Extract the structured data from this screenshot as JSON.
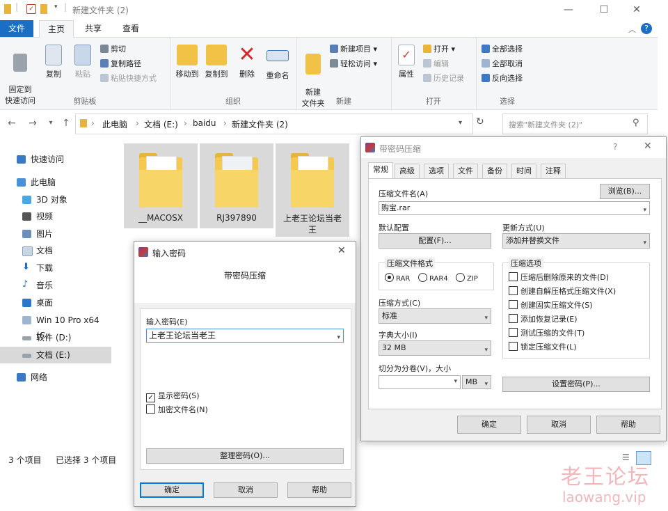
{
  "explorer": {
    "window_title": "新建文件夹 (2)",
    "ribbon_tabs": [
      "文件",
      "主页",
      "共享",
      "查看"
    ],
    "clipboard_group": {
      "label": "剪贴板",
      "pin": "固定到\n快速访问",
      "copy": "复制",
      "paste": "粘贴",
      "cut": "剪切",
      "copy_path": "复制路径",
      "paste_shortcut": "粘贴快捷方式"
    },
    "organize_group": {
      "label": "组织",
      "move_to": "移动到",
      "copy_to": "复制到",
      "delete": "删除",
      "rename": "重命名"
    },
    "new_group": {
      "label": "新建",
      "new_folder": "新建\n文件夹",
      "new_item": "新建项目 ▾",
      "easy_access": "轻松访问 ▾"
    },
    "open_group": {
      "label": "打开",
      "properties": "属性",
      "open": "打开 ▾",
      "edit": "编辑",
      "history": "历史记录"
    },
    "select_group": {
      "label": "选择",
      "select_all": "全部选择",
      "select_none": "全部取消",
      "invert": "反向选择"
    },
    "breadcrumb": [
      "此电脑",
      "文档 (E:)",
      "baidu",
      "新建文件夹 (2)"
    ],
    "search_placeholder": "搜索\"新建文件夹 (2)\"",
    "sidebar": [
      {
        "label": "快速访问"
      },
      {
        "label": "此电脑"
      },
      {
        "label": "3D 对象"
      },
      {
        "label": "视频"
      },
      {
        "label": "图片"
      },
      {
        "label": "文档"
      },
      {
        "label": "下载"
      },
      {
        "label": "音乐"
      },
      {
        "label": "桌面"
      },
      {
        "label": "Win 10 Pro x64 (C:"
      },
      {
        "label": "软件 (D:)"
      },
      {
        "label": "文档 (E:)"
      },
      {
        "label": "网络"
      }
    ],
    "files": [
      {
        "name": "__MACOSX"
      },
      {
        "name": "RJ397890"
      },
      {
        "name": "上老王论坛当老\n王"
      }
    ],
    "status": {
      "count": "3 个项目",
      "selected": "已选择 3 个项目"
    }
  },
  "password_dialog": {
    "title": "输入密码",
    "heading": "带密码压缩",
    "field_label": "输入密码(E)",
    "field_value": "上老王论坛当老王",
    "show_password": "显示密码(S)",
    "encrypt_names": "加密文件名(N)",
    "organize_button": "整理密码(O)...",
    "ok": "确定",
    "cancel": "取消",
    "help": "帮助"
  },
  "archive_dialog": {
    "title": "带密码压缩",
    "help_glyph": "?",
    "tabs": [
      "常规",
      "高级",
      "选项",
      "文件",
      "备份",
      "时间",
      "注释"
    ],
    "archive_name_label": "压缩文件名(A)",
    "browse": "浏览(B)...",
    "archive_name": "购宝.rar",
    "default_profile_label": "默认配置",
    "profile_button": "配置(F)...",
    "update_mode_label": "更新方式(U)",
    "update_mode": "添加并替换文件",
    "format_group": "压缩文件格式",
    "formats": [
      "RAR",
      "RAR4",
      "ZIP"
    ],
    "method_label": "压缩方式(C)",
    "method": "标准",
    "dict_label": "字典大小(I)",
    "dict": "32 MB",
    "split_label": "切分为分卷(V)，大小",
    "split_unit": "MB",
    "options_group": "压缩选项",
    "options": [
      "压缩后删除原来的文件(D)",
      "创建自解压格式压缩文件(X)",
      "创建固实压缩文件(S)",
      "添加恢复记录(E)",
      "测试压缩的文件(T)",
      "锁定压缩文件(L)"
    ],
    "set_password": "设置密码(P)...",
    "ok": "确定",
    "cancel": "取消",
    "help": "帮助"
  },
  "watermark": {
    "line1": "老王论坛",
    "line2": "laowang.vip"
  },
  "colors": {
    "accent": "#1a6fc4",
    "folder": "#f4c94e",
    "selection": "#cce8ff",
    "watermark": "#f1b7bb"
  }
}
